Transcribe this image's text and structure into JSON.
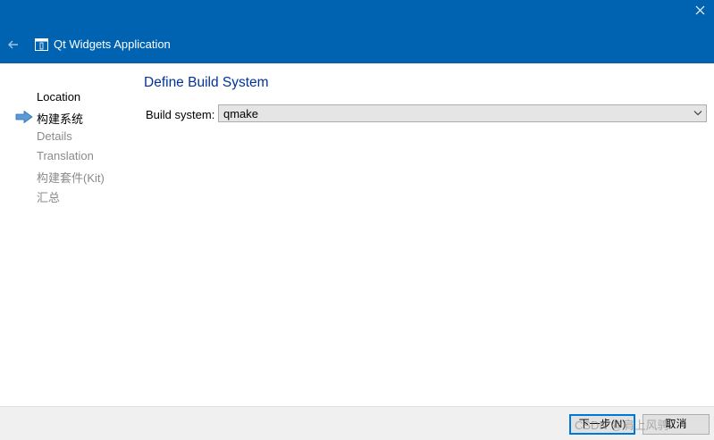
{
  "window": {
    "title": "Qt Widgets Application",
    "close_glyph": "✕",
    "back_icon": "back-arrow-icon",
    "app_icon": "window-icon",
    "titlebar_color": "#0063b1"
  },
  "steps": [
    {
      "label": "Location",
      "state": "done"
    },
    {
      "label": "构建系统",
      "state": "current"
    },
    {
      "label": "Details",
      "state": "pending"
    },
    {
      "label": "Translation",
      "state": "pending"
    },
    {
      "label": "构建套件(Kit)",
      "state": "pending"
    },
    {
      "label": "汇总",
      "state": "pending"
    }
  ],
  "page": {
    "title": "Define Build System",
    "build_system_label": "Build system:",
    "build_system_value": "qmake"
  },
  "buttons": {
    "next": "下一步(N)",
    "cancel": "取消"
  },
  "watermark": "CSDN @肩上风骋"
}
